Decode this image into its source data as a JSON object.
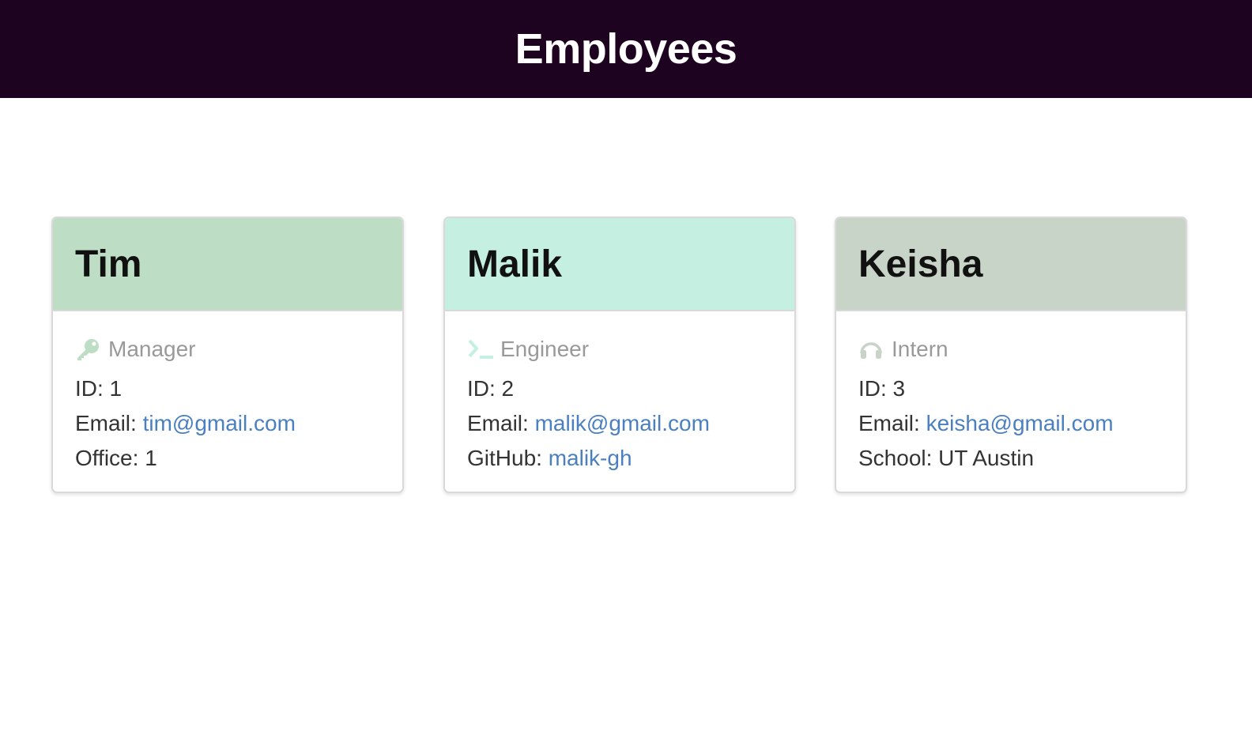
{
  "header": {
    "title": "Employees"
  },
  "colors": {
    "topbar": "#1e0320",
    "manager_header": "#bdddc5",
    "engineer_header": "#c5f0e1",
    "intern_header": "#c8d4c8",
    "link": "#4a7fc0"
  },
  "cards": [
    {
      "name": "Tim",
      "role": "Manager",
      "icon": "key-icon",
      "id_label": "ID: 1",
      "email_prefix": "Email: ",
      "email": "tim@gmail.com",
      "extra_prefix": "Office: ",
      "extra_value": "1"
    },
    {
      "name": "Malik",
      "role": "Engineer",
      "icon": "terminal-icon",
      "id_label": "ID: 2",
      "email_prefix": "Email: ",
      "email": "malik@gmail.com",
      "extra_prefix": "GitHub: ",
      "extra_value": "malik-gh"
    },
    {
      "name": "Keisha",
      "role": "Intern",
      "icon": "headphones-icon",
      "id_label": "ID: 3",
      "email_prefix": "Email: ",
      "email": "keisha@gmail.com",
      "extra_prefix": "School: ",
      "extra_value": "UT Austin"
    }
  ]
}
